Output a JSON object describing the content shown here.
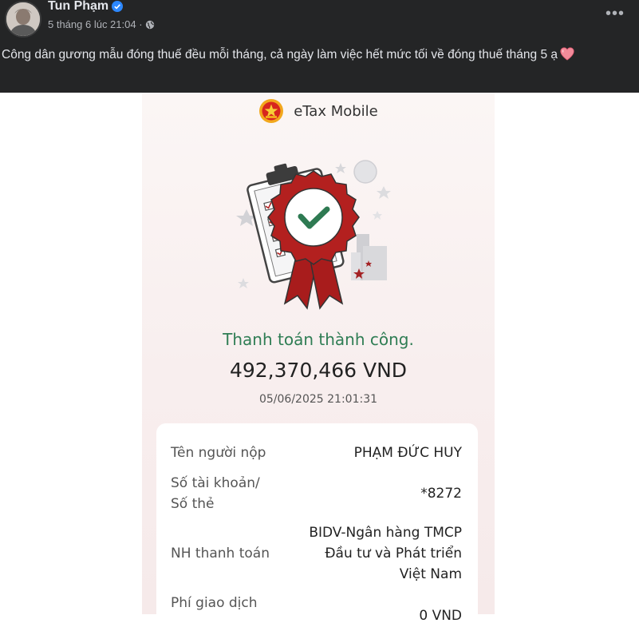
{
  "post": {
    "author": "Tun Phạm",
    "meta": "5 tháng 6 lúc 21:04 ·",
    "text": "Công dân gương mẫu đóng thuế đều mỗi tháng, cả ngày làm việc hết mức tối về đóng thuế tháng 5 ạ",
    "more_label": "•••"
  },
  "etax": {
    "app_name": "eTax Mobile",
    "status": "Thanh toán thành công.",
    "amount": "492,370,466 VND",
    "datetime": "05/06/2025 21:01:31",
    "details": [
      {
        "label": "Tên người nộp",
        "value": "PHẠM ĐỨC HUY"
      },
      {
        "label": "Số tài khoản/\nSố thẻ",
        "value": "*8272"
      },
      {
        "label": "NH thanh toán",
        "value": "BIDV-Ngân hàng TMCP\nĐầu tư và Phát triển\nViệt Nam"
      },
      {
        "label": "Phí giao dịch",
        "value": "0 VND"
      }
    ]
  },
  "colors": {
    "fb_bg": "#242526",
    "verified_blue": "#2d88ff",
    "success_green": "#2f7d54",
    "ribbon_red": "#b22222"
  },
  "icons": [
    "avatar",
    "verified-badge-icon",
    "globe-icon",
    "more-options-icon",
    "heart-emoji-icon",
    "etax-emblem-icon",
    "payment-success-ribbon-icon"
  ]
}
